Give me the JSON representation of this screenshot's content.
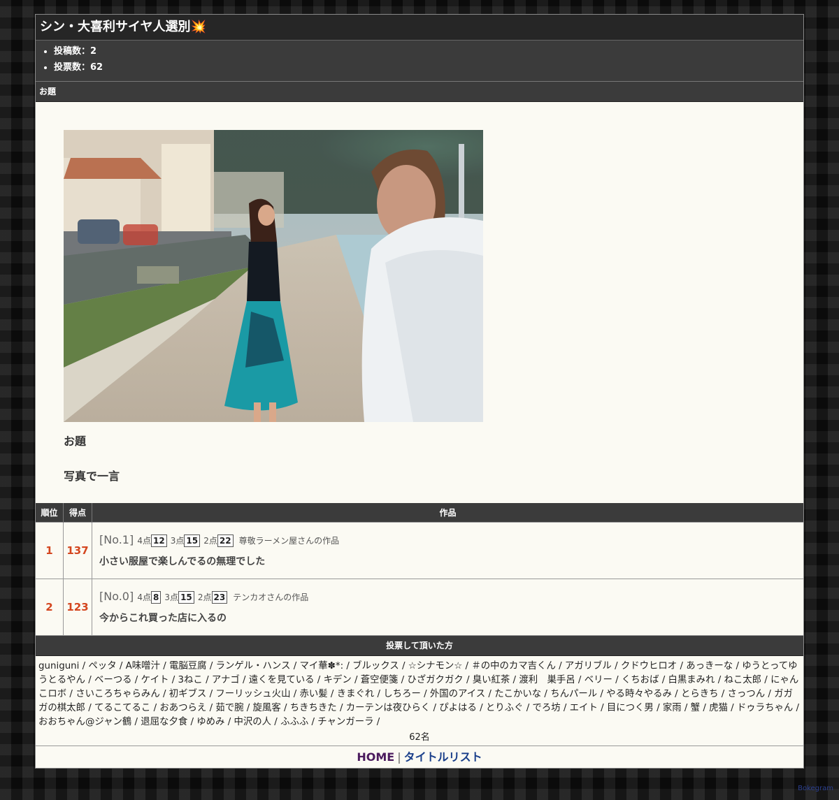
{
  "page": {
    "title": "シン・大喜利サイヤ人選別💥",
    "stats": [
      "投稿数：2",
      "投票数：62"
    ]
  },
  "odai": {
    "header": "お題",
    "label": "お題",
    "text": "写真で一言"
  },
  "ranking": {
    "columns": [
      "順位",
      "得点",
      "作品"
    ],
    "rows": [
      {
        "rank": "1",
        "score": "137",
        "no": "[No.1]",
        "pts4_label": "4点",
        "pts4": "12",
        "pts3_label": "3点",
        "pts3": "15",
        "pts2_label": "2点",
        "pts2": "22",
        "author": "尊敬ラーメン屋さんの作品",
        "text": "小さい服屋で楽しんでるの無理でした"
      },
      {
        "rank": "2",
        "score": "123",
        "no": "[No.0]",
        "pts4_label": "4点",
        "pts4": "8",
        "pts3_label": "3点",
        "pts3": "15",
        "pts2_label": "2点",
        "pts2": "23",
        "author": "テンカオさんの作品",
        "text": "今からこれ買った店に入るの"
      }
    ]
  },
  "voters": {
    "header": "投票して頂いた方",
    "names": [
      "guniguni",
      "ペッタ",
      "A味噌汁",
      "電脳豆腐",
      "ランゲル・ハンス",
      "マイ華✽*:",
      "ブルックス",
      "☆シナモン☆",
      "＃の中のカマ吉くん",
      "アガリブル",
      "クドウヒロオ",
      "あっきーな",
      "ゆうとってゆうとるやん",
      "ベーつる",
      "ケイト",
      "3ねこ",
      "アナゴ",
      "遠くを見ている",
      "キデン",
      "蒼空便箋",
      "ひざガクガク",
      "臭い紅茶",
      "渡利　巣手呂",
      "ベリー",
      "くちおば",
      "白黒まみれ",
      "ねこ太郎",
      "にゃんこロボ",
      "さいころちゃらみん",
      "初ギブス",
      "フーリッシュ火山",
      "赤い髪",
      "きまぐれ",
      "しちろー",
      "外国のアイス",
      "たこかいな",
      "ちんパール",
      "やる時々やるみ",
      "とらきち",
      "さっつん",
      "ガガガの棋太郎",
      "てるこてるこ",
      "おあつらえ",
      "茹で腕",
      "旋風客",
      "ちきちきた",
      "カーテンは夜ひらく",
      "ぴよはる",
      "とりふぐ",
      "でろ坊",
      "エイト",
      "目につく男",
      "家雨",
      "蟹",
      "虎猫",
      "ドゥラちゃん",
      "おおちゃん@ジャン鶴",
      "退屈な夕食",
      "ゆめみ",
      "中沢の人",
      "ふふふ",
      "チャンガーラ"
    ],
    "count": "62名"
  },
  "footer": {
    "home": "HOME",
    "separator": "|",
    "title_list": "タイトルリスト"
  },
  "brand": "Bokegram",
  "colors": {
    "rank_accent": "#d4461f",
    "header_bg": "#3b3b3b",
    "content_bg": "#fbfaf3",
    "home_link": "#4b1b5e",
    "list_link": "#1a3f8a"
  }
}
